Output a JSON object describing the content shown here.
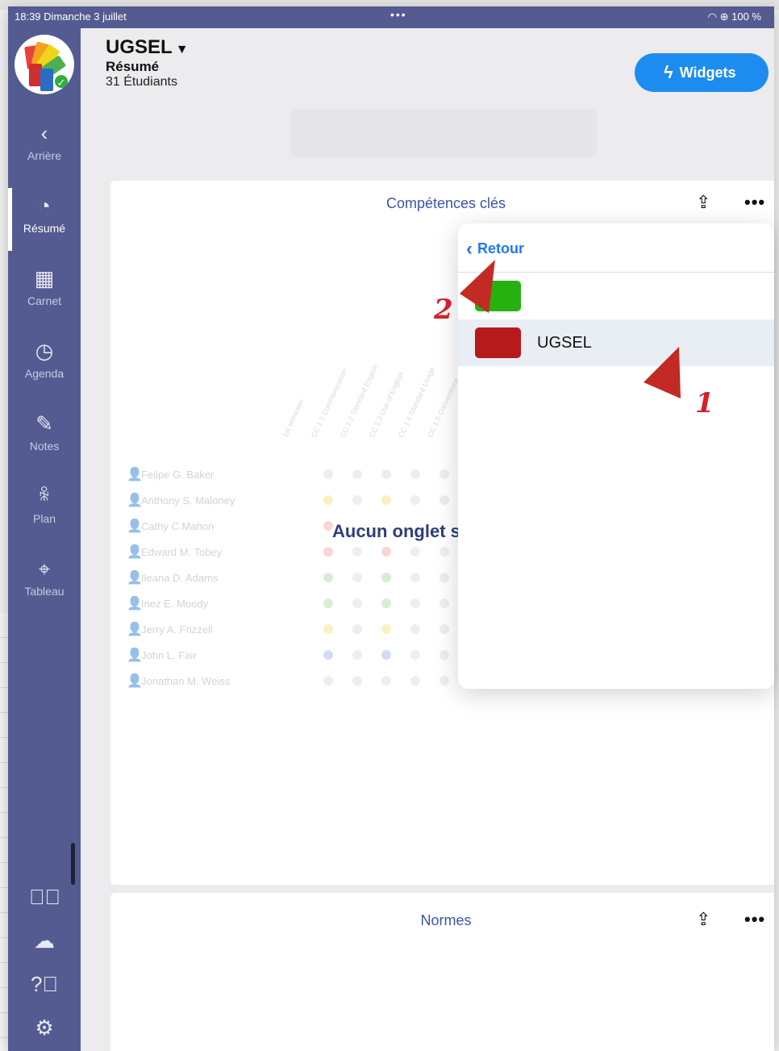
{
  "status_bar": {
    "time": "18:39",
    "date": "Dimanche 3 juillet",
    "battery": "100 %"
  },
  "sidebar": {
    "items": [
      {
        "label": "Arrière",
        "icon": "chevron-left-icon"
      },
      {
        "label": "Résumé",
        "icon": "pie-chart-icon",
        "active": true
      },
      {
        "label": "Carnet",
        "icon": "gradebook-grid-icon"
      },
      {
        "label": "Agenda",
        "icon": "clock-bubble-icon"
      },
      {
        "label": "Notes",
        "icon": "pencil-icon"
      },
      {
        "label": "Plan",
        "icon": "people-icon"
      },
      {
        "label": "Tableau",
        "icon": "pin-icon"
      }
    ],
    "bottom_icons": [
      "checkmark-circle-icon",
      "cloud-upload-icon",
      "help-circle-icon",
      "settings-gear-icon"
    ]
  },
  "header": {
    "title": "UGSEL",
    "subtitle": "Résumé",
    "count": "31 Étudiants"
  },
  "widgets_button": {
    "label": "Widgets"
  },
  "card1": {
    "title": "Compétences clés",
    "empty_message": "Aucun onglet sé",
    "students": [
      "Felipe G. Baker",
      "Anthony S. Maloney",
      "Cathy C.Mahon",
      "Edward M. Tobey",
      "Ileana D. Adams",
      "Inez E. Moody",
      "Jerry A. Frizzell",
      "John L. Fair",
      "Jonathan M. Weiss"
    ]
  },
  "card2": {
    "title": "Normes"
  },
  "popover": {
    "back_label": "Retour",
    "rows": [
      {
        "label": "",
        "color": "#27b10f"
      },
      {
        "label": "UGSEL",
        "color": "#b51b1b",
        "selected": true
      }
    ]
  },
  "annotations": {
    "mark_1": "1",
    "mark_2": "2"
  },
  "colors": {
    "sidebar": "#545b90",
    "accent": "#1d8cf1",
    "annotation": "#d3202a"
  }
}
